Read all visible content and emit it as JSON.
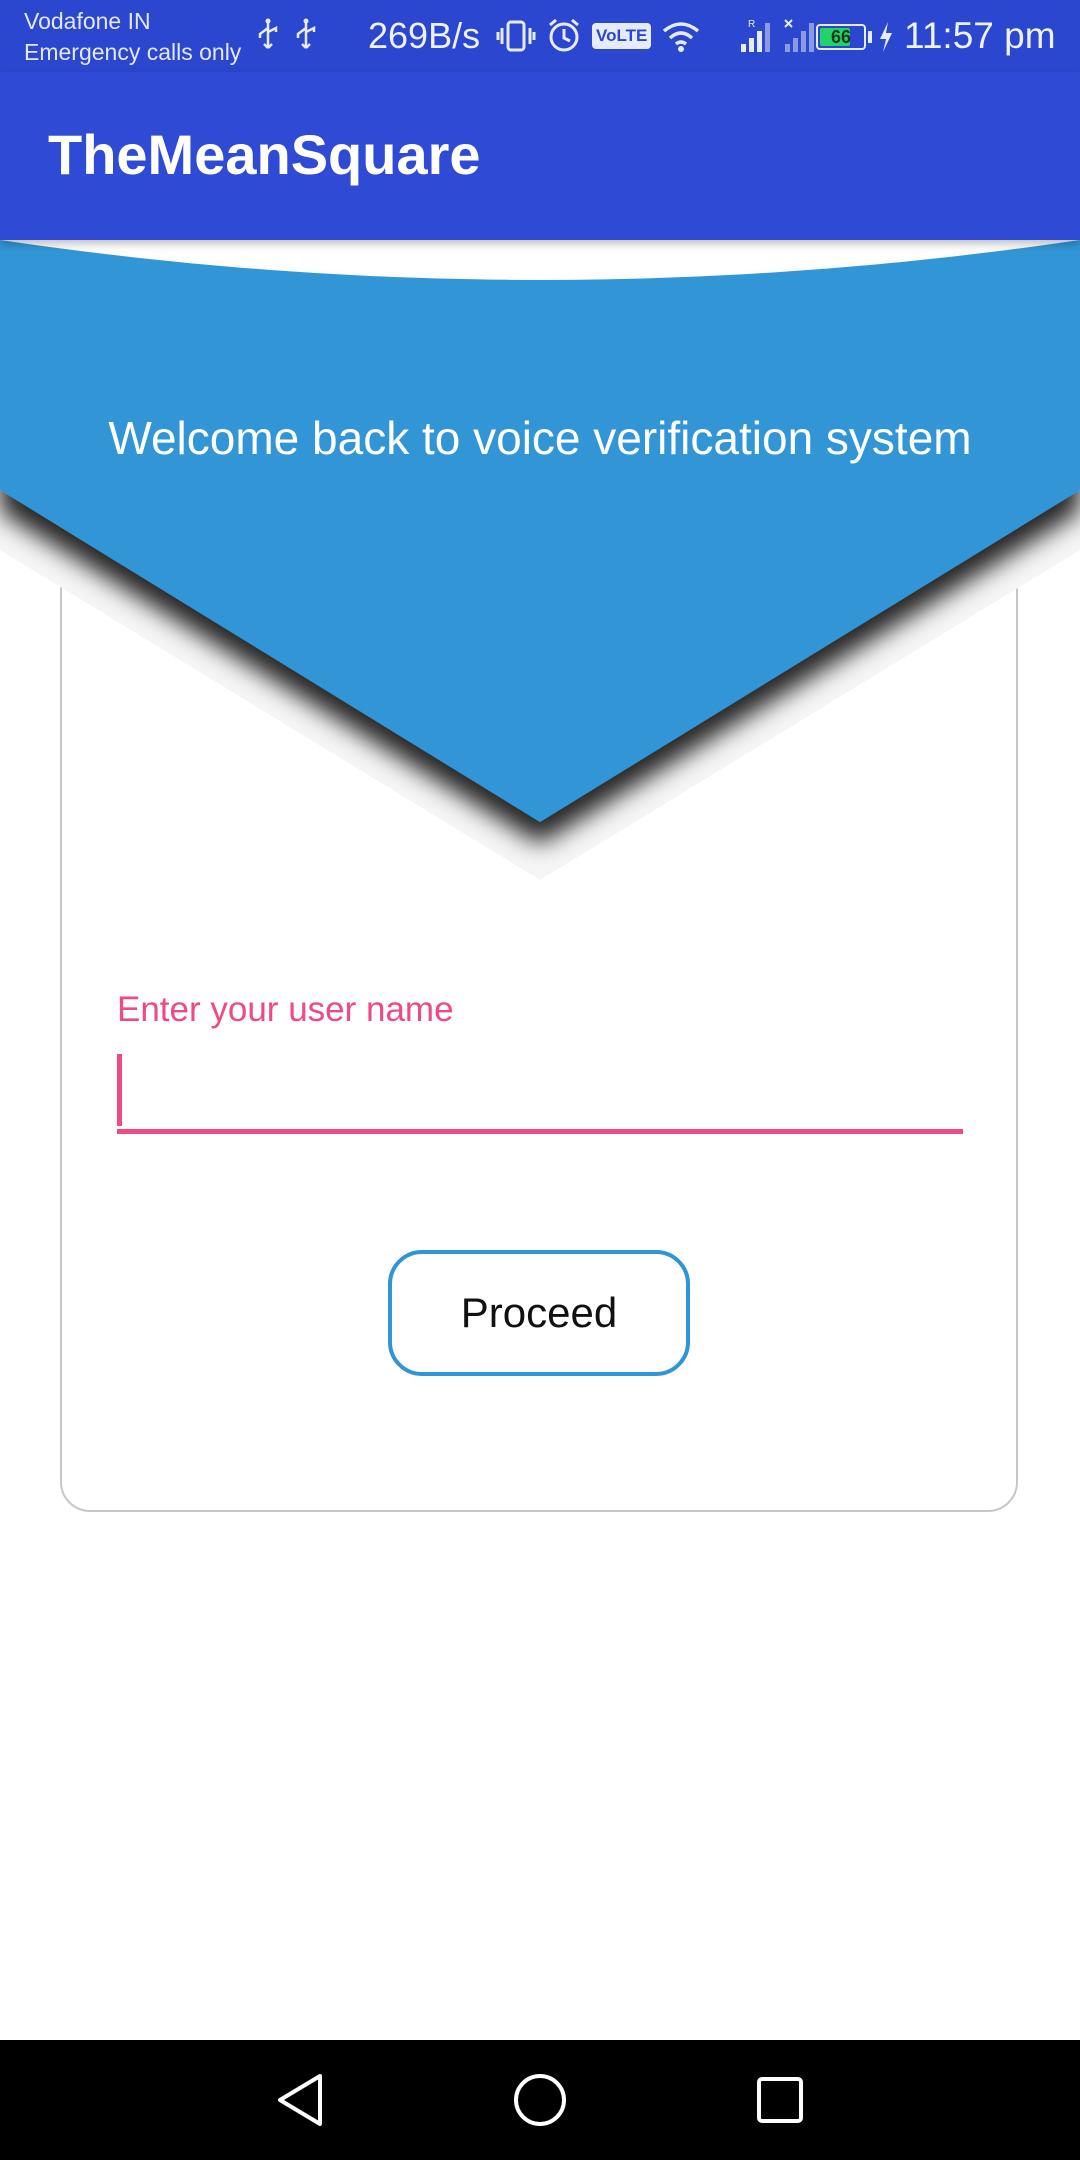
{
  "status_bar": {
    "carrier_line1": "Vodafone IN",
    "carrier_line2": "Emergency calls only",
    "net_speed": "269B/s",
    "volte": "VoLTE",
    "battery_level": "66",
    "battery_fraction": 0.66,
    "time": "11:57 pm",
    "icons": [
      "usb-icon",
      "usb-icon",
      "vibrate-icon",
      "alarm-icon",
      "volte-icon",
      "wifi-icon",
      "signal-icon",
      "signal-icon",
      "battery-icon",
      "charging-icon"
    ]
  },
  "app_bar": {
    "title": "TheMeanSquare"
  },
  "header": {
    "welcome_text": "Welcome back to voice verification system"
  },
  "form": {
    "username_label": "Enter your user name",
    "username_value": "",
    "proceed_label": "Proceed"
  },
  "nav_bar": {
    "icons": [
      "back-icon",
      "home-icon",
      "recents-icon"
    ]
  },
  "colors": {
    "status_bar": "#2b46cf",
    "app_bar": "#2f4bd6",
    "banner": "#3196d6",
    "accent": "#ee4a85",
    "button_border": "#2f95d6",
    "battery": "#22d26b"
  }
}
